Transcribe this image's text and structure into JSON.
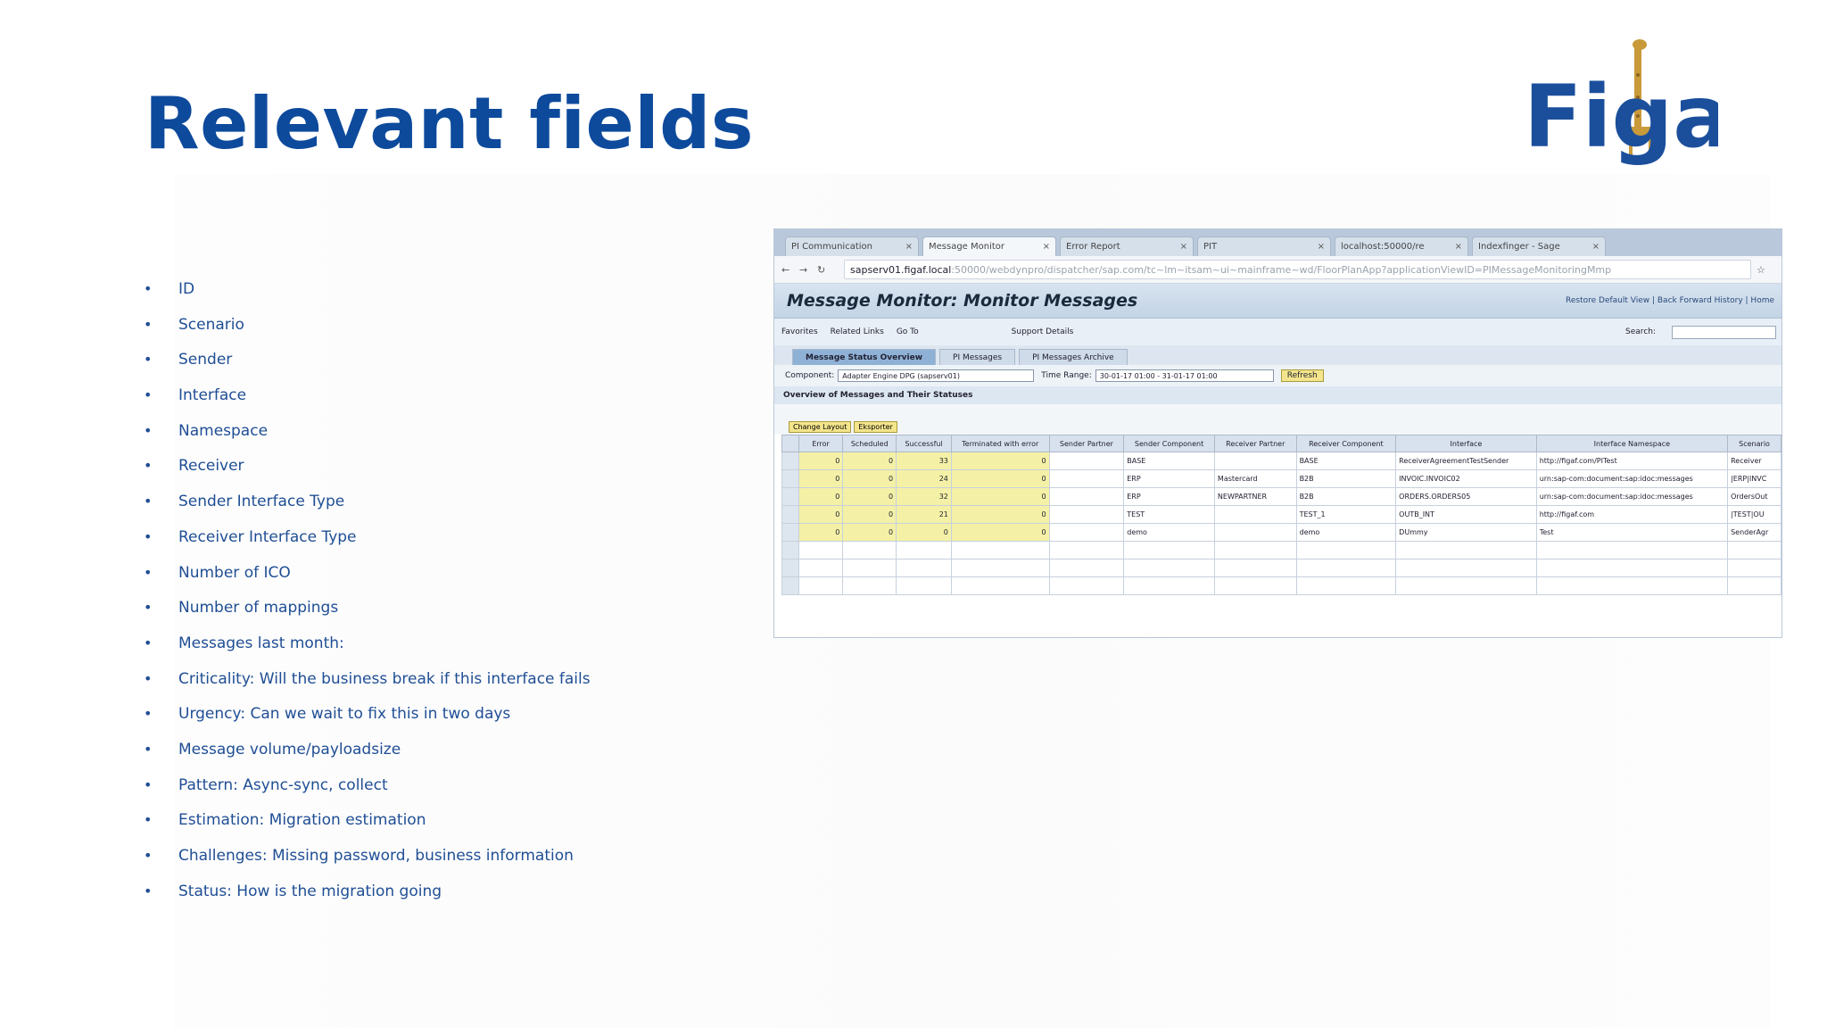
{
  "title": "Relevant fields",
  "logo_text": "Figaf",
  "colors": {
    "title": "#0d4a9c",
    "bullet_text": "#1f4e94",
    "logo_blue": "#1b4f9c",
    "logo_gold": "#c99a3a"
  },
  "bullets": [
    "ID",
    "Scenario",
    "Sender",
    "Interface",
    "Namespace",
    "Receiver",
    "Sender Interface Type",
    "Receiver Interface Type",
    "Number of ICO",
    "Number of mappings",
    "Messages last month:",
    "Criticality: Will the business break if this interface fails",
    "Urgency: Can we wait to fix this in two days",
    "Message volume/payloadsize",
    "Pattern: Async-sync, collect",
    "Estimation: Migration estimation",
    "Challenges: Missing password, business information",
    "Status: How is the migration going"
  ],
  "screenshot": {
    "tabs": [
      "PI Communication",
      "Message Monitor",
      "Error Report",
      "PIT",
      "localhost:50000/re",
      "Indexfinger - Sage"
    ],
    "url_host": "sapserv01.figaf.local",
    "url_path": ":50000/webdynpro/dispatcher/sap.com/tc~lm~itsam~ui~mainframe~wd/FloorPlanApp?applicationViewID=PIMessageMonitoringMmp",
    "app_title": "Message Monitor: Monitor Messages",
    "header_links": "Restore Default View  |  Back  Forward  History  |  Home",
    "menu": [
      "Favorites",
      "Related Links",
      "Go To",
      "Support Details"
    ],
    "search_label": "Search:",
    "subtabs": [
      "Message Status Overview",
      "PI Messages",
      "PI Messages Archive"
    ],
    "component_label": "Component:",
    "component_value": "Adapter Engine DPG (sapserv01)",
    "time_label": "Time Range:",
    "time_value": "30-01-17 01:00 - 31-01-17 01:00",
    "refresh": "Refresh",
    "section": "Overview of Messages and Their Statuses",
    "toolbar": [
      "Change Layout",
      "Eksporter"
    ],
    "columns": [
      "Error",
      "Scheduled",
      "Successful",
      "Terminated with error",
      "Sender Partner",
      "Sender Component",
      "Receiver Partner",
      "Receiver Component",
      "Interface",
      "Interface Namespace",
      "Scenario"
    ],
    "rows": [
      [
        "0",
        "0",
        "33",
        "0",
        "",
        "BASE",
        "",
        "BASE",
        "ReceiverAgreementTestSender",
        "http://figaf.com/PITest",
        "Receiver"
      ],
      [
        "0",
        "0",
        "24",
        "0",
        "",
        "ERP",
        "Mastercard",
        "B2B",
        "INVOIC.INVOIC02",
        "urn:sap-com:document:sap:idoc:messages",
        "|ERP|INVC"
      ],
      [
        "0",
        "0",
        "32",
        "0",
        "",
        "ERP",
        "NEWPARTNER",
        "B2B",
        "ORDERS.ORDERS05",
        "urn:sap-com:document:sap:idoc:messages",
        "OrdersOut"
      ],
      [
        "0",
        "0",
        "21",
        "0",
        "",
        "TEST",
        "",
        "TEST_1",
        "OUTB_INT",
        "http://figaf.com",
        "|TEST|OU"
      ],
      [
        "0",
        "0",
        "0",
        "0",
        "",
        "demo",
        "",
        "demo",
        "DUmmy",
        "Test",
        "SenderAgr"
      ]
    ]
  }
}
